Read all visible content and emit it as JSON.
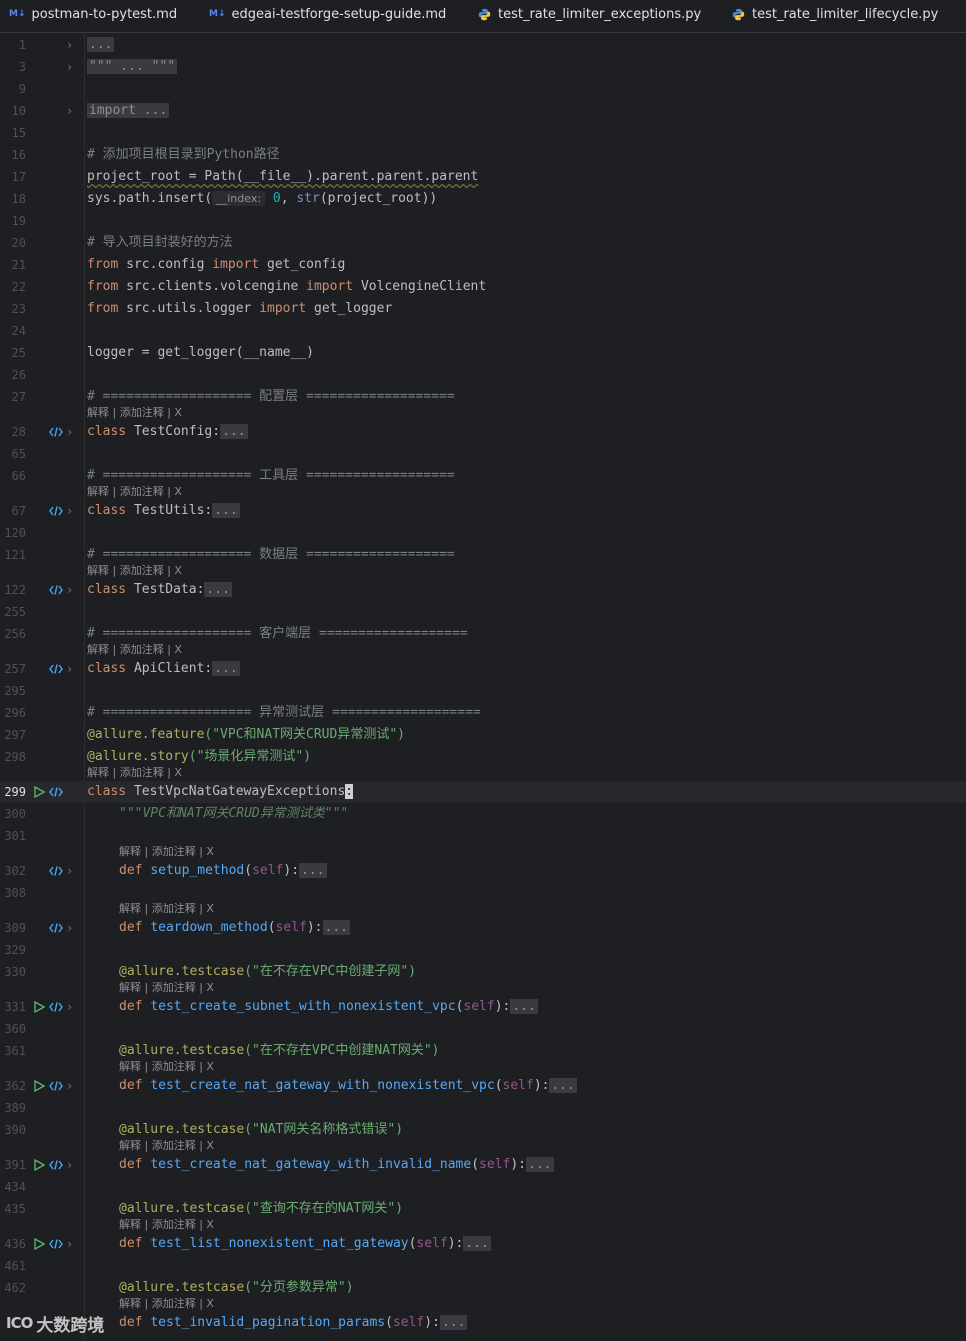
{
  "tabs": [
    {
      "icon": "markdown-icon",
      "badge": "M↓",
      "label": "postman-to-pytest.md"
    },
    {
      "icon": "markdown-icon",
      "badge": "M↓",
      "label": "edgeai-testforge-setup-guide.md"
    },
    {
      "icon": "python-icon",
      "label": "test_rate_limiter_exceptions.py"
    },
    {
      "icon": "python-icon",
      "label": "test_rate_limiter_lifecycle.py"
    }
  ],
  "editor": {
    "hint_text": "解释 | 添加注释 | X",
    "param_hint": "__index:",
    "fold_placeholder": "...",
    "line_numbers": {
      "l1": "1",
      "l3": "3",
      "l9": "9",
      "l10": "10",
      "l15": "15",
      "l16": "16",
      "l17": "17",
      "l18": "18",
      "l19": "19",
      "l20": "20",
      "l21": "21",
      "l22": "22",
      "l23": "23",
      "l24": "24",
      "l25": "25",
      "l26": "26",
      "l27": "27",
      "l28": "28",
      "l65": "65",
      "l66": "66",
      "l67": "67",
      "l120": "120",
      "l121": "121",
      "l122": "122",
      "l255": "255",
      "l256": "256",
      "l257": "257",
      "l295": "295",
      "l296": "296",
      "l297": "297",
      "l298": "298",
      "l299": "299",
      "l300": "300",
      "l301": "301",
      "l302": "302",
      "l308": "308",
      "l309": "309",
      "l329": "329",
      "l330": "330",
      "l331": "331",
      "l360": "360",
      "l361": "361",
      "l362": "362",
      "l389": "389",
      "l390": "390",
      "l391": "391",
      "l434": "434",
      "l435": "435",
      "l436": "436",
      "l461": "461",
      "l462": "462"
    },
    "code": {
      "docstring_fold": "\"\"\" ... \"\"\"",
      "import_fold": "import ...",
      "c16": "# 添加项目根目录到Python路径",
      "l17_a": "project_root = Path(__file__).parent.parent.parent",
      "l18_a": "sys.path.insert(",
      "l18_num": "0",
      "l18_comma": ", ",
      "l18_str": "str",
      "l18_b": "(project_root))",
      "c20": "# 导入项目封装好的方法",
      "from": "from",
      "import": "import",
      "l21_mod": " src.config ",
      "l21_name": " get_config",
      "l22_mod": " src.clients.volcengine ",
      "l22_name": " VolcengineClient",
      "l23_mod": " src.utils.logger ",
      "l23_name": " get_logger",
      "l25": "logger = get_logger(__name__)",
      "c27": "# =================== 配置层 ===================",
      "class": "class",
      "def": "def",
      "l28_name": " TestConfig:",
      "c66": "# =================== 工具层 ===================",
      "l67_name": " TestUtils:",
      "c121": "# =================== 数据层 ===================",
      "l122_name": " TestData:",
      "c256": "# =================== 客户端层 ===================",
      "l257_name": " ApiClient:",
      "c296": "# =================== 异常测试层 ===================",
      "dec_feature": "@allure.feature",
      "dec_story": "@allure.story",
      "dec_testcase": "@allure.testcase",
      "s297": "(\"VPC和NAT网关CRUD异常测试\")",
      "s298": "(\"场景化异常测试\")",
      "l299_name": " TestVpcNatGatewayExceptions",
      "l299_colon": ":",
      "doc300": "\"\"\"VPC和NAT网关CRUD异常测试类\"\"\"",
      "self": "self",
      "f302": "setup_method",
      "f309": "teardown_method",
      "s330": "(\"在不存在VPC中创建子网\")",
      "f331": "test_create_subnet_with_nonexistent_vpc",
      "s361": "(\"在不存在VPC中创建NAT网关\")",
      "f362": "test_create_nat_gateway_with_nonexistent_vpc",
      "s390": "(\"NAT网关名称格式错误\")",
      "f391": "test_create_nat_gateway_with_invalid_name",
      "s435": "(\"查询不存在的NAT网关\")",
      "f436": "test_list_nonexistent_nat_gateway",
      "s462": "(\"分页参数异常\")",
      "f463": "test_invalid_pagination_params",
      "paren_open": "(",
      "paren_close": "):"
    }
  },
  "watermark": {
    "logo": "ICO",
    "text": "大数跨境"
  }
}
